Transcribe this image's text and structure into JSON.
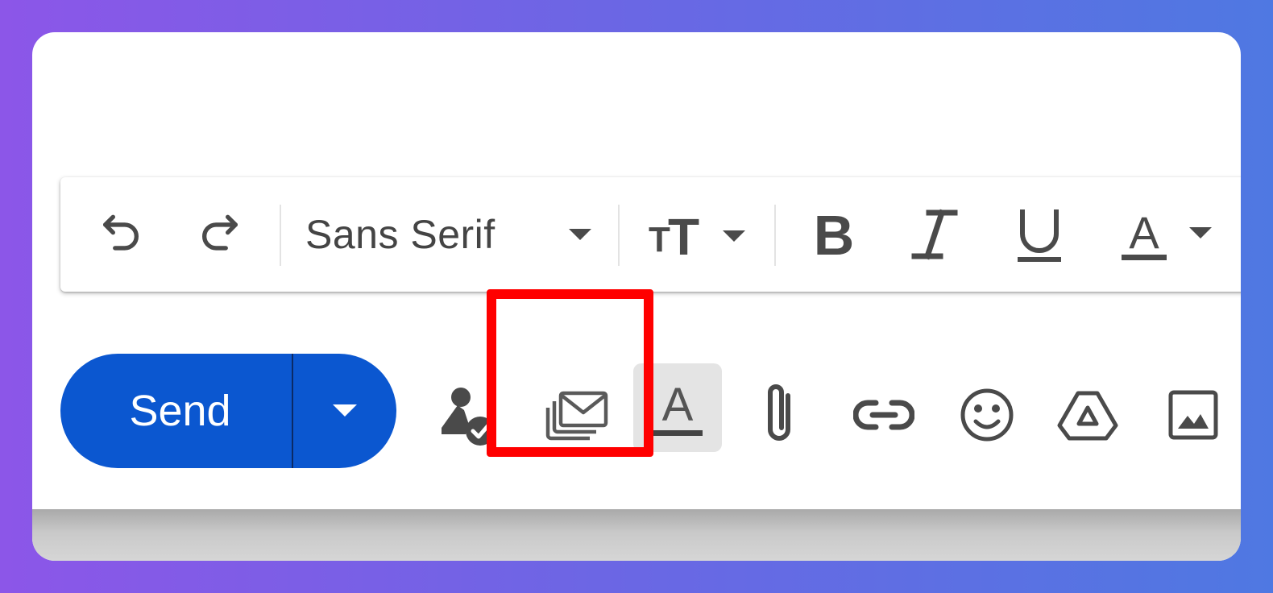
{
  "format_toolbar": {
    "undo_icon": "undo-icon",
    "redo_icon": "redo-icon",
    "font_family": "Sans Serif",
    "font_dropdown_icon": "dropdown-arrow-icon",
    "font_size_icon": "text-size-icon",
    "bold_icon": "bold-icon",
    "italic_icon": "italic-icon",
    "underline_icon": "underline-icon",
    "text_color_icon": "text-color-icon"
  },
  "bottom_toolbar": {
    "send_label": "Send",
    "send_more_icon": "dropdown-arrow-icon",
    "icons": [
      "signature-check-icon",
      "layered-mail-icon",
      "text-color-underline-icon",
      "paperclip-icon",
      "link-icon",
      "emoji-icon",
      "drive-icon",
      "image-icon"
    ]
  },
  "colors": {
    "send_blue": "#0b57d0",
    "highlight_red": "#ff0000",
    "icon_gray": "#4a4a4a"
  }
}
